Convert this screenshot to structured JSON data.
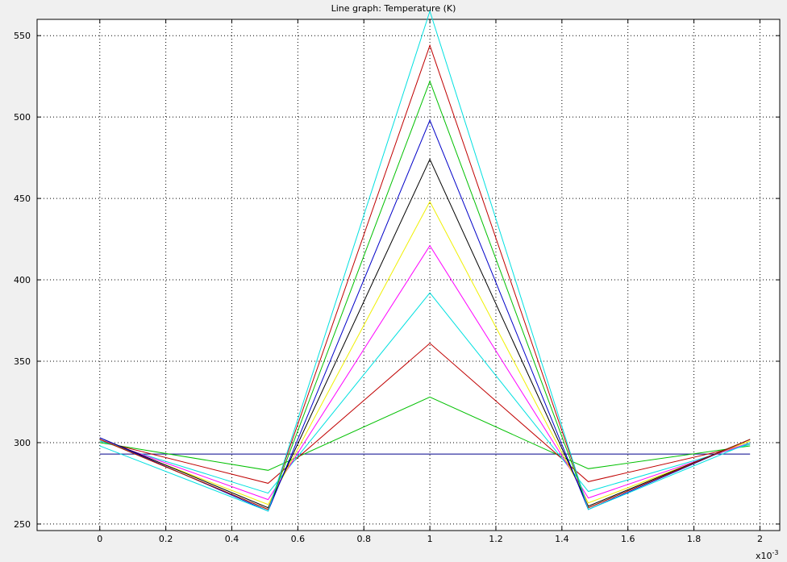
{
  "chart_data": {
    "type": "line",
    "title": "Line graph: Temperature (K)",
    "xlabel": "",
    "ylabel": "",
    "x_multiplier_label": {
      "base": "x10",
      "exponent": "-3"
    },
    "xlim": [
      -0.00019,
      0.00206
    ],
    "ylim": [
      246,
      560
    ],
    "x_ticks": [
      0,
      0.0002,
      0.0004,
      0.0006,
      0.0008,
      0.001,
      0.0012,
      0.0014,
      0.0016,
      0.0018,
      0.002
    ],
    "x_tick_labels": [
      "0",
      "0.2",
      "0.4",
      "0.6",
      "0.8",
      "1",
      "1.2",
      "1.4",
      "1.6",
      "1.8",
      "2"
    ],
    "y_ticks": [
      250,
      300,
      350,
      400,
      450,
      500,
      550
    ],
    "y_tick_labels": [
      "250",
      "300",
      "350",
      "400",
      "450",
      "500",
      "550"
    ],
    "grid": true,
    "x": [
      0,
      0.00051,
      0.001,
      0.00148,
      0.00197
    ],
    "series": [
      {
        "color": "#00008b",
        "values": [
          293,
          293,
          293,
          293,
          293
        ]
      },
      {
        "color": "#00c000",
        "values": [
          300,
          283,
          328,
          284,
          298
        ]
      },
      {
        "color": "#c00000",
        "values": [
          301,
          275,
          361,
          276,
          299
        ]
      },
      {
        "color": "#00e0e0",
        "values": [
          301,
          269,
          392,
          270,
          299
        ]
      },
      {
        "color": "#ff00ff",
        "values": [
          302,
          265,
          421,
          266,
          300
        ]
      },
      {
        "color": "#f0f000",
        "values": [
          302,
          262,
          448,
          263,
          301
        ]
      },
      {
        "color": "#000000",
        "values": [
          303,
          260,
          474,
          261,
          302
        ]
      },
      {
        "color": "#0000c8",
        "values": [
          303,
          258,
          498,
          259,
          302
        ]
      },
      {
        "color": "#00c000",
        "values": [
          302,
          259,
          522,
          260,
          302
        ]
      },
      {
        "color": "#c00000",
        "values": [
          302,
          259,
          544,
          260,
          302
        ]
      },
      {
        "color": "#00e0e0",
        "values": [
          298,
          258,
          565,
          259,
          300
        ]
      }
    ]
  }
}
